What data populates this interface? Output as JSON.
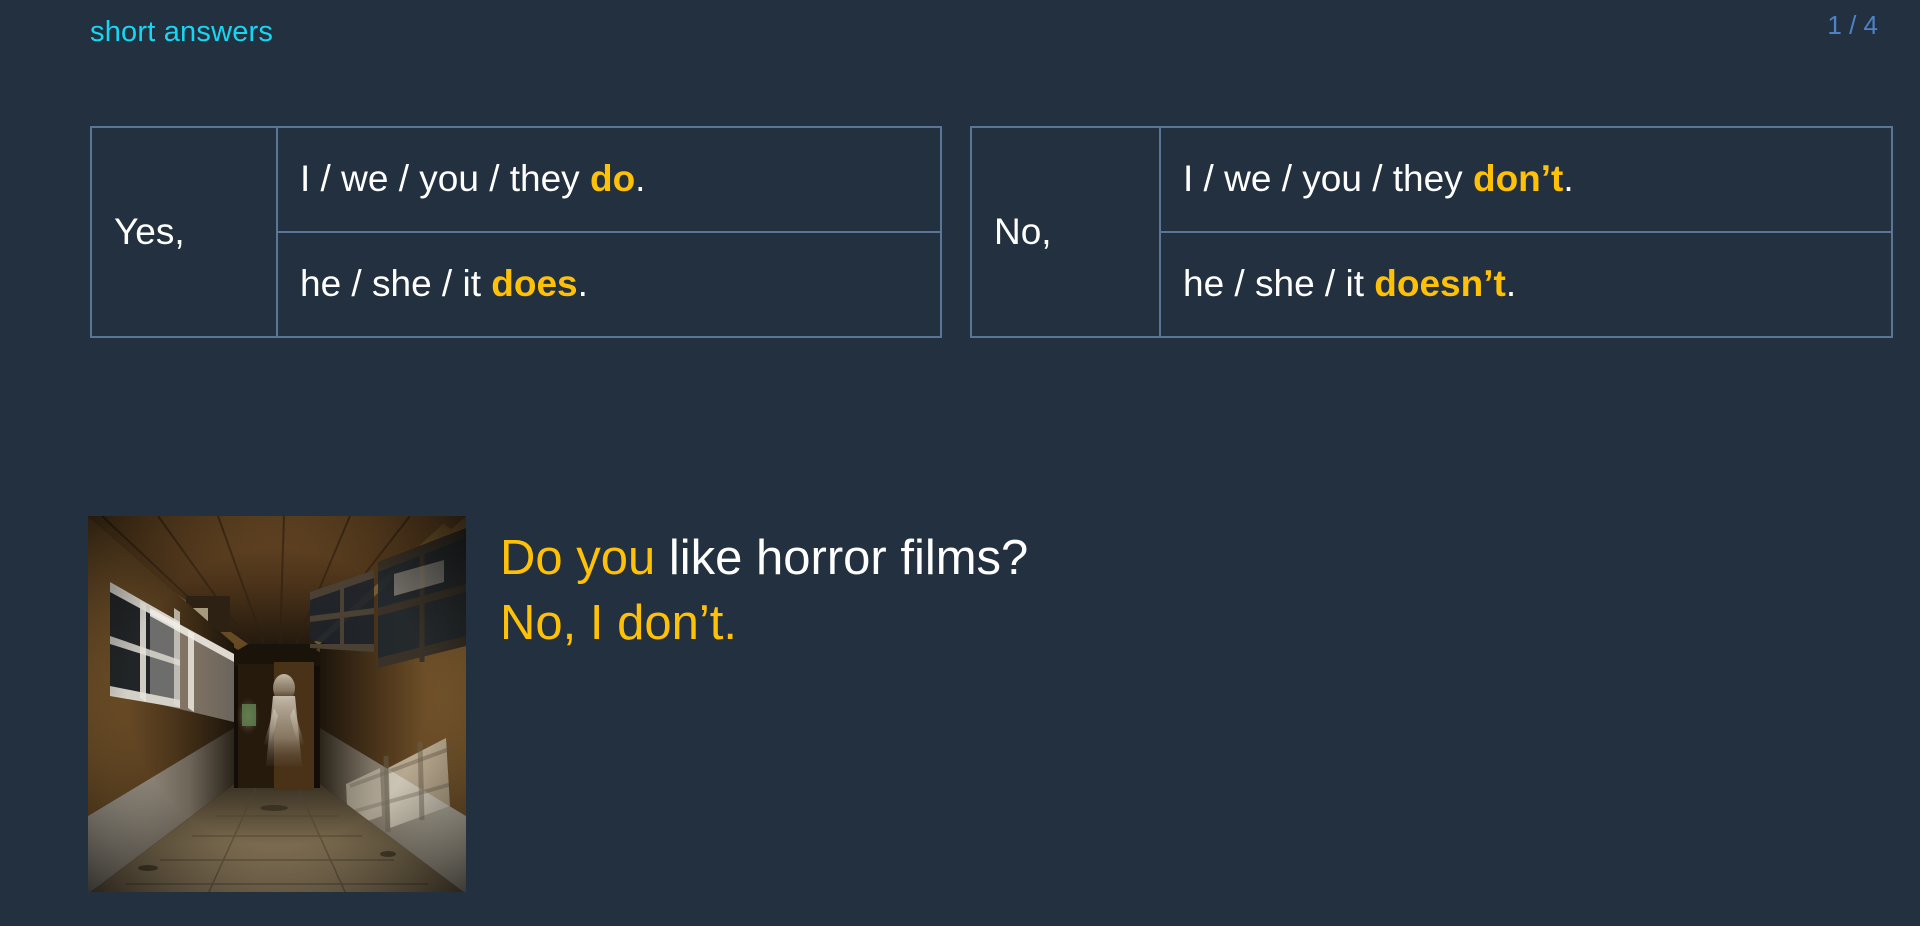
{
  "slide": {
    "title": "short answers",
    "page_indicator": "1 / 4",
    "background_color": "#22303f",
    "accent_color": "#ffc107",
    "title_color": "#17d6f2",
    "page_indicator_color": "#4f81c7",
    "border_color": "#5a7696"
  },
  "tables": {
    "affirmative": {
      "lead": "Yes,",
      "rows": [
        {
          "plain_before": "I / we / you / they ",
          "accent": "do",
          "plain_after": "."
        },
        {
          "plain_before": "he / she / it ",
          "accent": "does",
          "plain_after": "."
        }
      ]
    },
    "negative": {
      "lead": "No,",
      "rows": [
        {
          "plain_before": "I / we / you / they ",
          "accent": "don’t",
          "plain_after": "."
        },
        {
          "plain_before": "he / she / it ",
          "accent": "doesn’t",
          "plain_after": "."
        }
      ]
    }
  },
  "example": {
    "image_alt": "abandoned-corridor-horror-photo",
    "question": {
      "accent": "Do you",
      "plain": " like horror films?"
    },
    "answer": "No, I don’t."
  }
}
